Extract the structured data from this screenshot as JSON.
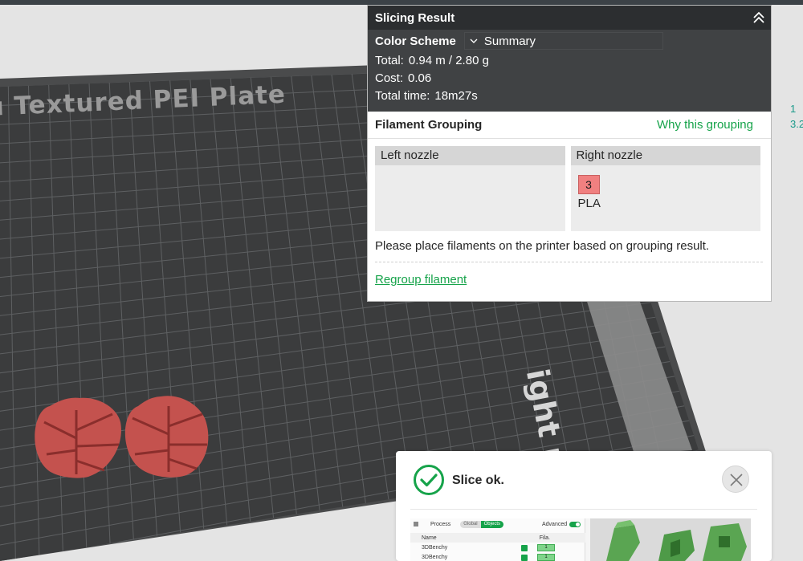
{
  "viewport": {
    "plate_label": "u Textured PEI Plate",
    "nozzle_label": "ight nozzle",
    "side_numbers": [
      "1",
      "3.2"
    ]
  },
  "slicing_result": {
    "title": "Slicing Result",
    "color_scheme_label": "Color Scheme",
    "color_scheme_value": "Summary",
    "total_label": "Total:",
    "total_value": "0.94 m / 2.80 g",
    "cost_label": "Cost:",
    "cost_value": "0.06",
    "time_label": "Total time:",
    "time_value": "18m27s"
  },
  "filament_grouping": {
    "title": "Filament Grouping",
    "why_link": "Why this grouping",
    "left_nozzle": "Left nozzle",
    "right_nozzle": "Right nozzle",
    "filament_number": "3",
    "filament_type": "PLA",
    "filament_color": "#f08080",
    "message": "Please place filaments on the printer based on grouping result.",
    "regroup_link": "Regroup filament"
  },
  "slice_notification": {
    "message": "Slice ok.",
    "accent": "#16a34a",
    "preview": {
      "process": "Process",
      "global": "Global",
      "objects": "Objects",
      "advanced": "Advanced",
      "col_name": "Name",
      "col_fila": "Fila.",
      "rows": [
        {
          "name": "3DBenchy",
          "fila": "1"
        },
        {
          "name": "3DBenchy",
          "fila": "1"
        }
      ]
    }
  }
}
